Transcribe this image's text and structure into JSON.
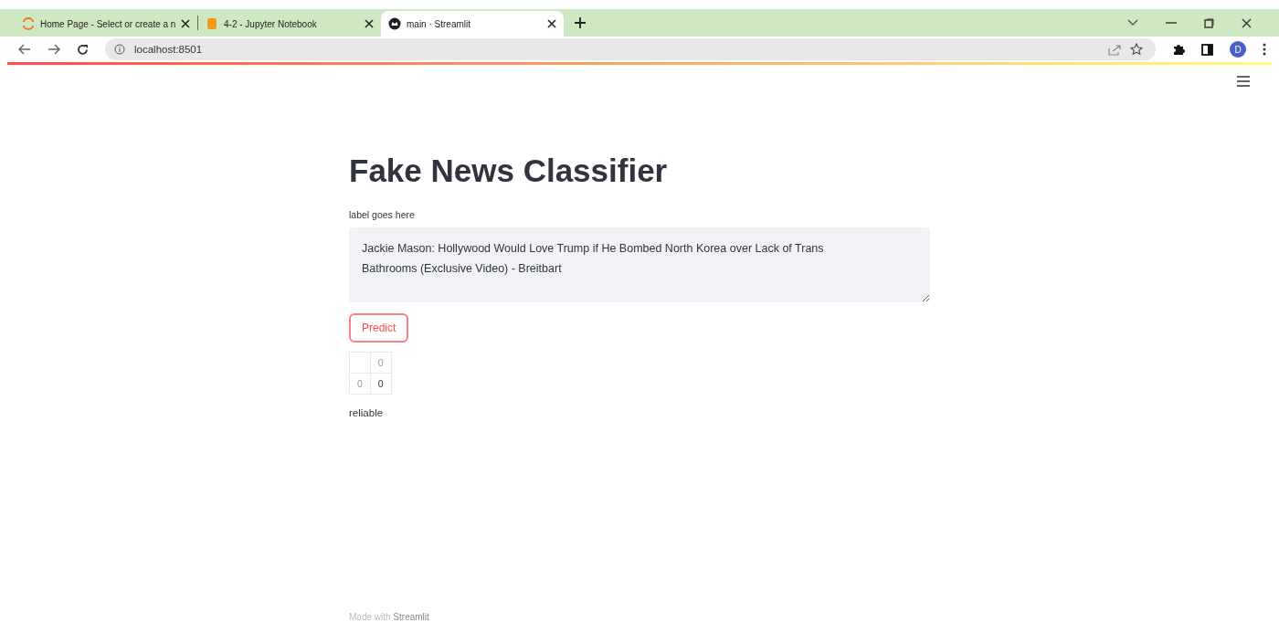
{
  "browser": {
    "tabs": [
      {
        "title": "Home Page - Select or create a n",
        "kind": "jupyter",
        "selected": false
      },
      {
        "title": "4-2 - Jupyter Notebook",
        "kind": "notebook",
        "selected": false
      },
      {
        "title": "main · Streamlit",
        "kind": "streamlit",
        "selected": true
      }
    ],
    "address": "localhost:8501",
    "profile": "D"
  },
  "page": {
    "title": "Fake News Classifier",
    "input_label": "label goes here",
    "input_value": "Jackie Mason: Hollywood Would Love Trump if He Bombed North Korea over Lack of Trans Bathrooms (Exclusive Video) - Breitbart",
    "button": "Predict",
    "table": {
      "header": "0",
      "rows": [
        {
          "index": "0",
          "value": "0"
        }
      ]
    },
    "result": "reliable",
    "footer": {
      "prefix": "Made with",
      "link": "Streamlit"
    }
  }
}
